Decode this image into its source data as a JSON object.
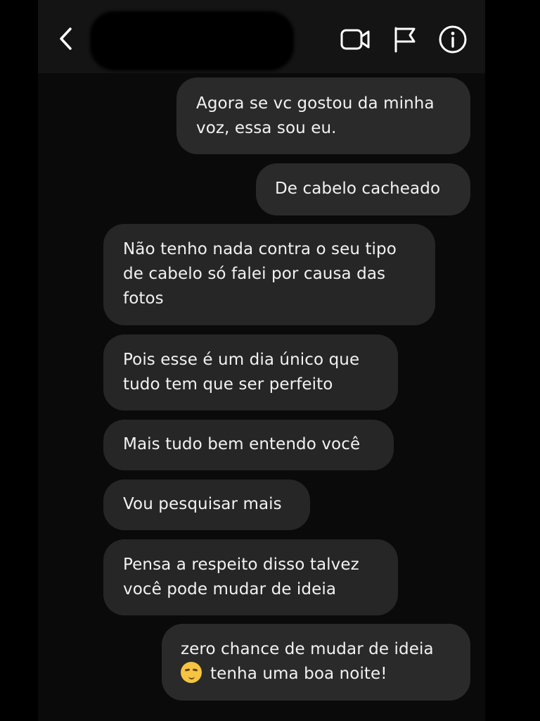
{
  "header": {
    "back_icon": "chevron-left-icon",
    "contact_name": "",
    "actions": [
      "video-call-icon",
      "flag-icon",
      "info-icon"
    ]
  },
  "messages": [
    {
      "direction": "sent",
      "lines": [
        "Agora se vc gostou da minha",
        "voz, essa sou eu."
      ]
    },
    {
      "direction": "sent",
      "lines": [
        "De cabelo cacheado"
      ]
    },
    {
      "direction": "received",
      "lines": [
        "Não tenho nada contra o seu tipo",
        "de cabelo só falei por causa das",
        "fotos"
      ]
    },
    {
      "direction": "received",
      "lines": [
        "Pois esse é um dia único que",
        "tudo tem que ser perfeito"
      ]
    },
    {
      "direction": "received",
      "lines": [
        "Mais tudo bem entendo você"
      ]
    },
    {
      "direction": "received",
      "lines": [
        "Vou pesquisar mais"
      ]
    },
    {
      "direction": "received",
      "lines": [
        "Pensa a respeito disso talvez",
        "você pode mudar de ideia"
      ]
    },
    {
      "direction": "sent",
      "lines": [
        "zero chance de mudar de ideia",
        "tenha uma boa noite!"
      ],
      "emoji": "relieved-face-emoji"
    }
  ],
  "colors": {
    "background": "#000000",
    "bubble": "#262626",
    "text": "#f2f2f2"
  }
}
